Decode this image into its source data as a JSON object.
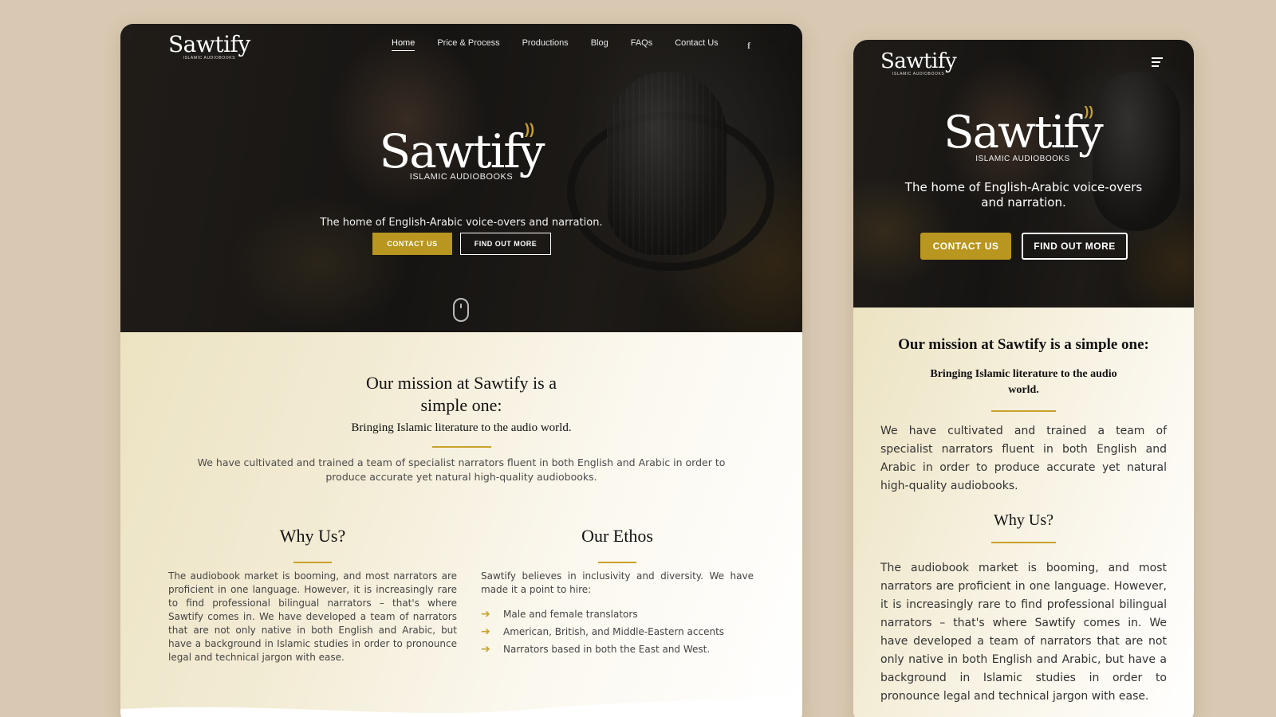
{
  "brand": {
    "name": "Sawtify",
    "subtitle": "ISLAMIC AUDIOBOOKS",
    "small_subtitle": "ISLAMIC AUDIOBOOKS",
    "gold": "#b8961f",
    "sound_icon": "sound-waves-icon",
    "sound_glyph": "))"
  },
  "desktop": {
    "nav": [
      "Home",
      "Price & Process",
      "Productions",
      "Blog",
      "FAQs",
      "Contact Us"
    ],
    "facebook_glyph": "f",
    "tagline": "The home of English-Arabic voice-overs and narration.",
    "contact_label": "CONTACT US",
    "more_label": "FIND OUT MORE",
    "mission_line1": "Our mission at Sawtify is a",
    "mission_line2": "simple one:",
    "bringing": "Bringing Islamic literature to the audio world.",
    "intro": "We have cultivated and trained a team of specialist narrators fluent in both English and Arabic in order to produce accurate yet natural high-quality audiobooks.",
    "why_title": "Why Us?",
    "why_text": "The audiobook market is booming, and most narrators are proficient in one language. However, it is increasingly rare to find professional bilingual narrators – that's where Sawtify comes in. We have developed a team of narrators that are not only native in both English and Arabic, but have a background in Islamic studies in order to pronounce legal and technical jargon with ease.",
    "ethos_title": "Our Ethos",
    "ethos_intro": "Sawtify believes in inclusivity and diversity. We have made it a point to hire:",
    "ethos_items": [
      "Male and female translators",
      "American, British, and Middle-Eastern accents",
      "Narrators based in both the East and West."
    ]
  },
  "mobile": {
    "menu_icon": "hamburger-menu-icon",
    "tagline": "The home of English-Arabic voice-overs and narration.",
    "contact_label": "CONTACT US",
    "more_label": "FIND OUT MORE",
    "mission": "Our mission at Sawtify is a simple one:",
    "bringing": "Bringing Islamic literature to the audio world.",
    "intro": "We have cultivated and trained a team of specialist narrators fluent in both English and Arabic in order to produce accurate yet natural high-quality audiobooks.",
    "why_title": "Why Us?",
    "why_text": "The audiobook market is booming, and most narrators are proficient in one language. However, it is increasingly rare to find professional bilingual narrators – that's where Sawtify comes in. We have developed a team of narrators that are not only native in both English and Arabic, but have a background in Islamic studies in order to pronounce legal and technical jargon with ease."
  }
}
